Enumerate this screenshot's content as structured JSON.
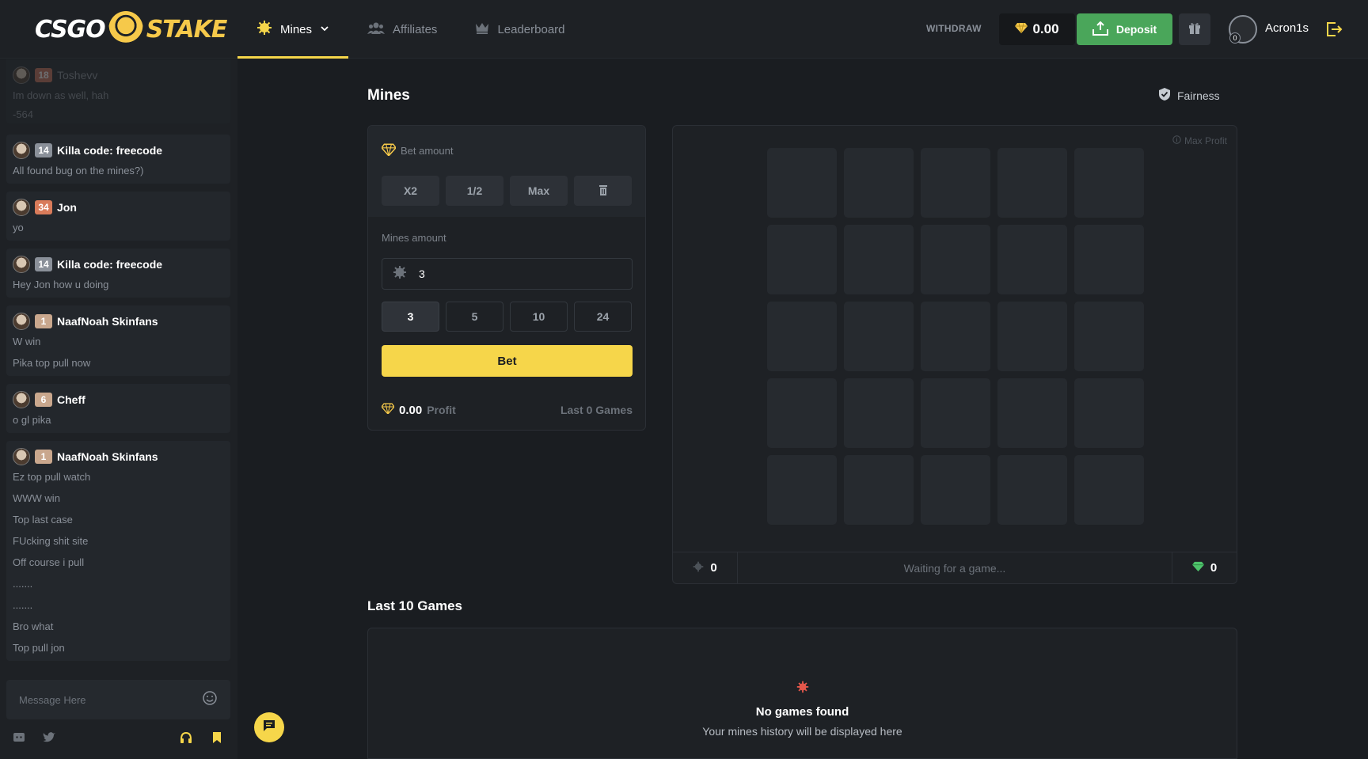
{
  "header": {
    "logo": {
      "left": "CSGO",
      "right": "STAKE"
    },
    "nav": [
      {
        "label": "Mines",
        "icon": "mine-icon",
        "active": true
      },
      {
        "label": "Affiliates",
        "icon": "users-icon"
      },
      {
        "label": "Leaderboard",
        "icon": "crown-icon"
      }
    ],
    "withdraw": "WITHDRAW",
    "balance": "0.00",
    "deposit": "Deposit",
    "user": {
      "name": "Acron1s",
      "level": "0"
    }
  },
  "chat": {
    "messages": [
      {
        "name": "Toshevv",
        "level": "18",
        "level_color": "#c9735a",
        "lines": [
          "Im down as well, hah",
          "-564"
        ]
      },
      {
        "name": "Killa code: freecode",
        "level": "14",
        "level_color": "#8a9099",
        "lines": [
          "All found bug on the mines?)"
        ]
      },
      {
        "name": "Jon",
        "level": "34",
        "level_color": "#d97b5a",
        "lines": [
          "yo"
        ]
      },
      {
        "name": "Killa code: freecode",
        "level": "14",
        "level_color": "#8a9099",
        "lines": [
          "Hey Jon how u doing"
        ]
      },
      {
        "name": "NaafNoah Skinfans",
        "level": "1",
        "level_color": "#c9a78d",
        "lines": [
          "W win",
          "Pika top pull now"
        ]
      },
      {
        "name": "Cheff",
        "level": "6",
        "level_color": "#c9a78d",
        "lines": [
          "o gl pika"
        ]
      },
      {
        "name": "NaafNoah Skinfans",
        "level": "1",
        "level_color": "#c9a78d",
        "lines": [
          "Ez top pull watch",
          "WWW win",
          "Top last case",
          "FUcking shit site",
          "Off course i pull",
          ".......",
          ".......",
          "Bro what",
          "Top pull jon"
        ]
      }
    ],
    "input_placeholder": "Message Here"
  },
  "main": {
    "title": "Mines",
    "fairness": "Fairness",
    "bet": {
      "bet_amount_label": "Bet amount",
      "buttons": [
        "X2",
        "1/2",
        "Max"
      ],
      "mines_amount_label": "Mines amount",
      "mines_value": "3",
      "mine_options": [
        "3",
        "5",
        "10",
        "24"
      ],
      "selected_mines": "3",
      "bet_label": "Bet",
      "profit_value": "0.00",
      "profit_label": "Profit",
      "last_games": "Last 0 Games"
    },
    "grid": {
      "max_profit": "Max Profit",
      "rows": 5,
      "cols": 5,
      "mines_count": "0",
      "status": "Waiting for a game...",
      "gems_count": "0"
    },
    "history": {
      "title": "Last 10 Games",
      "empty_title": "No games found",
      "empty_subtitle": "Your mines history will be displayed here"
    }
  },
  "colors": {
    "accent": "#f6d64a",
    "deposit": "#4aa65a",
    "bg": "#1a1d21"
  }
}
